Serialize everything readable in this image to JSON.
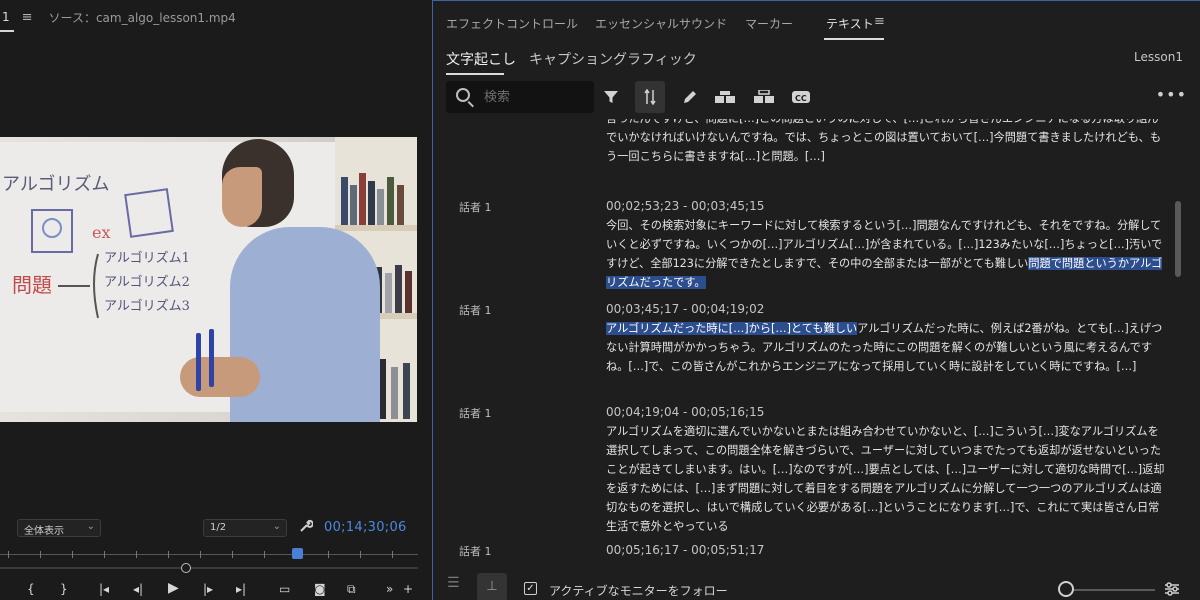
{
  "source_monitor": {
    "tab_label": "1",
    "menu_glyph": "≡",
    "source_label": "ソース：cam_algo_lesson1.mp4",
    "zoom_select": "全体表示",
    "resolution_select": "1/2",
    "timecode": "00;14;30;06"
  },
  "panel": {
    "tabs": [
      "エフェクトコントロール",
      "エッセンシャルサウンド",
      "マーカー",
      "テキスト"
    ],
    "active_tab": "テキスト",
    "menu_glyph": "≡",
    "subtabs": [
      "文字起こし",
      "キャプション",
      "グラフィック"
    ],
    "lesson": "Lesson1",
    "search_placeholder": "検索",
    "follow_label": "アクティブなモニターをフォロー"
  },
  "transcript": {
    "block0_text": "言ったんですけど、問題に[…]この問題というのに対して、[…]これから皆さんエンジニアになる方は取り組んでいかなければいけないんですね。では、ちょっとこの図は置いておいて[…]今問題て書きましたけれども、もう一回こちらに書きますね[…]と問題。[…]",
    "blocks": [
      {
        "speaker": "話者 1",
        "timecode": "00;02;53;23 - 00;03;45;15",
        "text_plain": "今回、その検索対象にキーワードに対して検索するという[…]問題なんですけれども、それをですね。分解していくと必ずですね。いくつかの[…]アルゴリズム[…]が含まれている。[…]123みたいな[…]ちょっと[…]汚いですけど、全部123に分解できたとしますで、その中の全部または一部がとても難しい",
        "text_selected": "問題で問題というかアルゴリズムだったです。"
      },
      {
        "speaker": "話者 1",
        "timecode": "00;03;45;17 - 00;04;19;02",
        "text_selected": "アルゴリズムだった時に[…]から[…]とても難しい",
        "text_plain": "アルゴリズムだった時に、例えば2番がね。とても[…]えげつない計算時間がかかっちゃう。アルゴリズムのたった時にこの問題を解くのが難しいという風に考えるんですね。[…]で、この皆さんがこれからエンジニアになって採用していく時に設計をしていく時にですね。[…]"
      },
      {
        "speaker": "話者 1",
        "timecode": "00;04;19;04 - 00;05;16;15",
        "text_plain": "アルゴリズムを適切に選んでいかないとまたは組み合わせていかないと、[…]こういう[…]変なアルゴリズムを選択してしまって、この問題全体を解きづらいで、ユーザーに対していつまでたっても返却が返せないといったことが起きてしまいます。はい。[…]なのですが[…]要点としては、[…]ユーザーに対して適切な時間で[…]返却を返すためには、[…]まず問題に対して着目をする問題をアルゴリズムに分解して一つ一つのアルゴリズムは適切なものを選択し、はいで構成していく必要がある[…]ということになります[…]で、これにて実は皆さん日常生活で意外とやっている"
      },
      {
        "speaker": "話者 1",
        "timecode": "00;05;16;17 - 00;05;51;17"
      }
    ]
  },
  "icons": {
    "search": "search-icon",
    "filter": "filter-icon",
    "sync": "sync-icon",
    "pencil": "pencil-icon",
    "merge": "merge-segments-icon",
    "split": "split-segments-icon",
    "cc": "closed-captions-icon",
    "more": "more-icon",
    "wrench": "wrench-icon",
    "settings": "settings-icon"
  },
  "colors": {
    "accent_blue": "#4a88e0",
    "selection": "#2c4d8e",
    "panel_border": "#3b63a8"
  }
}
